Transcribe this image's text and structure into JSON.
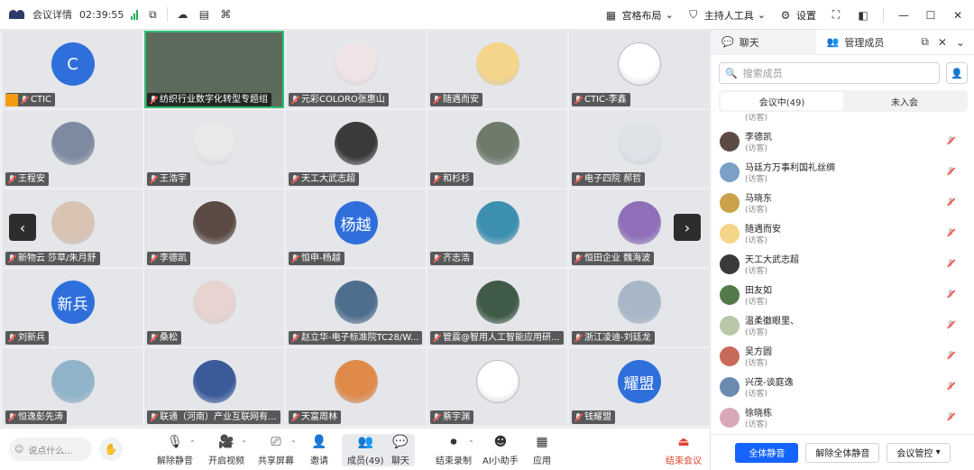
{
  "topbar": {
    "meeting_info": "会议详情",
    "timer": "02:39:55",
    "layout_label": "宫格布局",
    "host_tools_label": "主持人工具",
    "settings_label": "设置"
  },
  "tiles": [
    {
      "name": "CTIC",
      "initial": "C",
      "color": "#2f6fdb"
    },
    {
      "name": "纺织行业数字化转型专题组",
      "initial": "",
      "color": "#6a7a6a"
    },
    {
      "name": "元彩COLORO张惠山",
      "initial": "",
      "color": "#f0e4e6"
    },
    {
      "name": "随遇而安",
      "initial": "",
      "color": "#f4d58a"
    },
    {
      "name": "CTIC-李鑫",
      "initial": "",
      "color": "#ffffff"
    },
    {
      "name": "王程安",
      "initial": "",
      "color": "#7d8aa0"
    },
    {
      "name": "王浩宇",
      "initial": "",
      "color": "#e9e9e9"
    },
    {
      "name": "天工大武志超",
      "initial": "",
      "color": "#3a3a3a"
    },
    {
      "name": "和杉杉",
      "initial": "",
      "color": "#6e7b6b"
    },
    {
      "name": "电子四院 郝哲",
      "initial": "",
      "color": "#dfe3e8"
    },
    {
      "name": "新物云 莎草/朱月舒",
      "initial": "",
      "color": "#d9c3b2"
    },
    {
      "name": "李德凯",
      "initial": "",
      "color": "#5b4b44"
    },
    {
      "name": "恒申-杨越",
      "initial": "杨越",
      "color": "#2f6fdb"
    },
    {
      "name": "齐志浩",
      "initial": "",
      "color": "#3d8fb0"
    },
    {
      "name": "恒田企业 魏海波",
      "initial": "",
      "color": "#8e6fb8"
    },
    {
      "name": "刘新兵",
      "initial": "新兵",
      "color": "#2f6fdb"
    },
    {
      "name": "桑松",
      "initial": "",
      "color": "#e7d4d0"
    },
    {
      "name": "赵立华-电子标准院TC28/W...",
      "initial": "",
      "color": "#4e6e8e"
    },
    {
      "name": "管震@智用人工智能应用研...",
      "initial": "",
      "color": "#3f5a46"
    },
    {
      "name": "浙江凌迪-刘廷龙",
      "initial": "",
      "color": "#a7b7c7"
    },
    {
      "name": "恒逸彭先涛",
      "initial": "",
      "color": "#8fb3c8"
    },
    {
      "name": "联通（河南）产业互联网有...",
      "initial": "",
      "color": "#3a5a9a"
    },
    {
      "name": "天富周林",
      "initial": "",
      "color": "#e08a4a"
    },
    {
      "name": "蔡宇渊",
      "initial": "",
      "color": "#ffffff"
    },
    {
      "name": "钱耀盟",
      "initial": "耀盟",
      "color": "#2f6fdb"
    }
  ],
  "nav": {
    "prev": "‹",
    "next": "›"
  },
  "toolbar": {
    "speak_placeholder": "说点什么...",
    "unmute": "解除静音",
    "video": "开启视频",
    "share": "共享屏幕",
    "invite": "邀请",
    "members": "成员(49)",
    "chat": "聊天",
    "record": "结束录制",
    "ai": "AI小助手",
    "apps": "应用",
    "end": "结束会议"
  },
  "panel": {
    "tab_chat": "聊天",
    "tab_members": "管理成员",
    "search_placeholder": "搜索成员",
    "seg_in": "会议中(49)",
    "seg_out": "未入会",
    "top_role": "(访客)",
    "members": [
      {
        "name": "李德凯",
        "role": "(访客)",
        "color": "#5b4b44"
      },
      {
        "name": "马廷方万事利国礼丝绸",
        "role": "(访客)",
        "color": "#7aa0c8"
      },
      {
        "name": "马晓东",
        "role": "(访客)",
        "color": "#c9a24a"
      },
      {
        "name": "随遇而安",
        "role": "(访客)",
        "color": "#f4d58a"
      },
      {
        "name": "天工大武志超",
        "role": "(访客)",
        "color": "#3a3a3a"
      },
      {
        "name": "田友如",
        "role": "(访客)",
        "color": "#557a4a"
      },
      {
        "name": "温柔徽眼里、",
        "role": "(访客)",
        "color": "#b8c8a8"
      },
      {
        "name": "吴方圆",
        "role": "(访客)",
        "color": "#c86a5a"
      },
      {
        "name": "兴茂-谈庭逸",
        "role": "(访客)",
        "color": "#6a8ab0"
      },
      {
        "name": "徐晓栋",
        "role": "(访客)",
        "color": "#d8a8b8"
      }
    ],
    "mute_all": "全体静音",
    "unmute_all": "解除全体静音",
    "control": "会议管控"
  }
}
